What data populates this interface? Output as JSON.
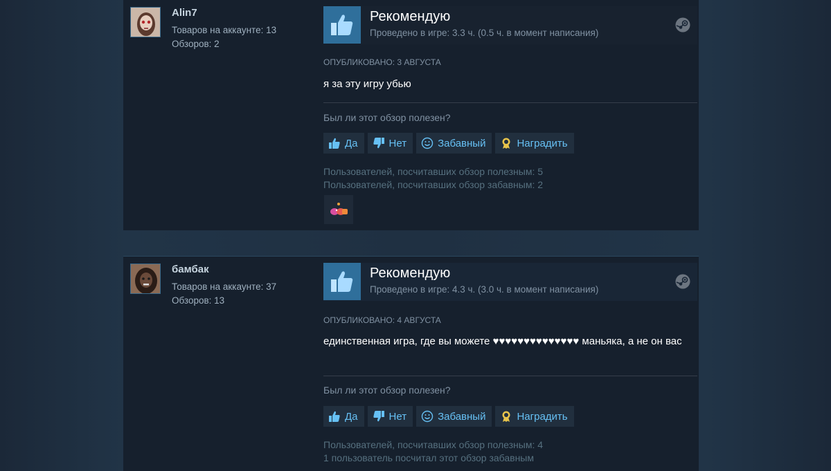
{
  "reviews": [
    {
      "author": {
        "name": "Alin7",
        "products": "Товаров на аккаунте: 13",
        "reviews": "Обзоров: 2"
      },
      "vote": {
        "title": "Рекомендую",
        "hours": "Проведено в игре: 3.3 ч. (0.5 ч. в момент написания)"
      },
      "posted": "Опубликовано: 3 августа",
      "text": "я за эту игру убью",
      "helpful_question": "Был ли этот обзор полезен?",
      "buttons": {
        "yes": "Да",
        "no": "Нет",
        "funny": "Забавный",
        "award": "Наградить"
      },
      "stats": [
        "Пользователей, посчитавших обзор полезным: 5",
        "Пользователей, посчитавших обзор забавным: 2"
      ]
    },
    {
      "author": {
        "name": "бамбак",
        "products": "Товаров на аккаунте: 37",
        "reviews": "Обзоров: 13"
      },
      "vote": {
        "title": "Рекомендую",
        "hours": "Проведено в игре: 4.3 ч. (3.0 ч. в момент написания)"
      },
      "posted": "Опубликовано: 4 августа",
      "text": "единственная игра, где вы можете ♥♥♥♥♥♥♥♥♥♥♥♥♥♥ маньяка, а не он вас",
      "helpful_question": "Был ли этот обзор полезен?",
      "buttons": {
        "yes": "Да",
        "no": "Нет",
        "funny": "Забавный",
        "award": "Наградить"
      },
      "stats": [
        "Пользователей, посчитавших обзор полезным: 4",
        "1 пользователь посчитал этот обзор забавным"
      ]
    }
  ],
  "icons": {
    "thumb": "thumbs-up-icon",
    "steam": "steam-logo-icon",
    "award_badge": "award-badge-icon"
  },
  "colors": {
    "accent": "#66c0f4",
    "thumb_box": "#2f6f9b",
    "panel": "#16202d"
  }
}
